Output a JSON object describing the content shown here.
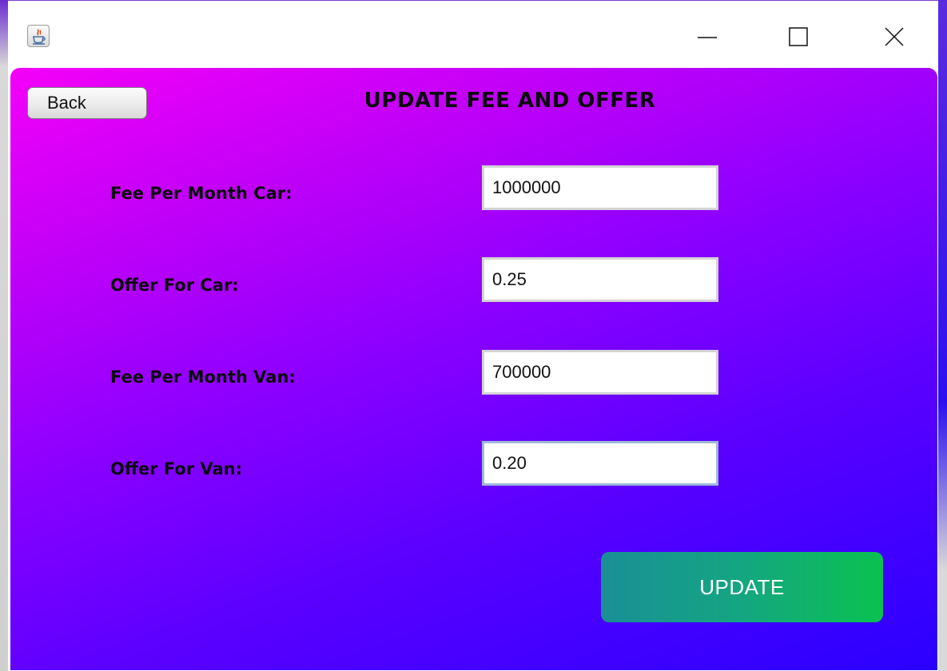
{
  "window": {
    "icon": "java-cup-icon",
    "controls": {
      "minimize": "minimize-icon",
      "maximize": "maximize-icon",
      "close": "close-icon"
    }
  },
  "header": {
    "back_label": "Back",
    "title": "UPDATE FEE AND OFFER"
  },
  "form": {
    "fields": [
      {
        "label": "Fee Per Month Car:",
        "value": "1000000"
      },
      {
        "label": "Offer For Car:",
        "value": "0.25"
      },
      {
        "label": "Fee Per Month Van:",
        "value": "700000"
      },
      {
        "label": "Offer For Van:",
        "value": "0.20"
      }
    ],
    "submit_label": "UPDATE"
  },
  "colors": {
    "gradient_start": "#f400f8",
    "gradient_end": "#2a00ff",
    "update_button_start": "#1a8f96",
    "update_button_end": "#0ac24f"
  }
}
